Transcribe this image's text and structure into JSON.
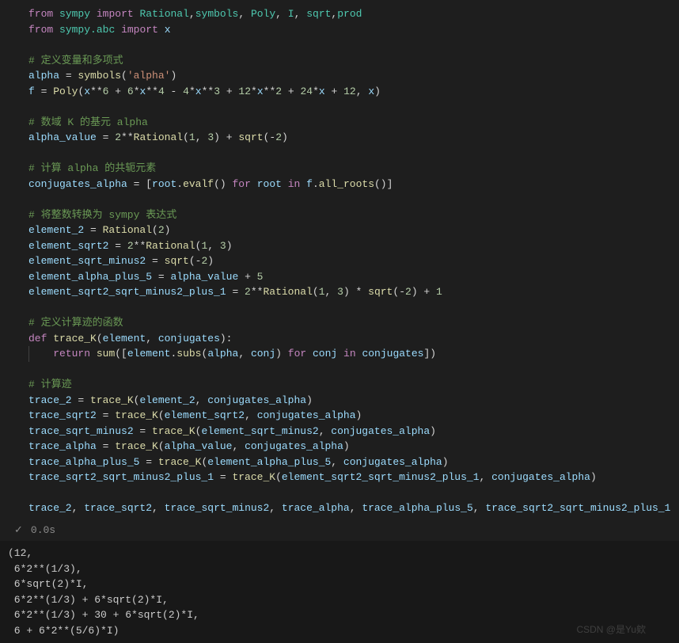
{
  "code": {
    "l1": {
      "from": "from",
      "mod": "sympy",
      "imp": "import",
      "items": "Rational,symbols, Poly, I, sqrt,prod"
    },
    "l2": {
      "from": "from",
      "mod": "sympy.abc",
      "imp": "import",
      "items": "x"
    },
    "l4_cmt": "# 定义变量和多项式",
    "l5": {
      "v": "alpha",
      "eq": " = ",
      "fn": "symbols",
      "args": "'alpha'"
    },
    "l6": {
      "v": "f",
      "eq": " = ",
      "fn": "Poly",
      "expr_a": "x**",
      "n6": "6",
      "p": " + ",
      "n6b": "6",
      "times": "*x**",
      "n4": "4",
      "minus": " - ",
      "n4b": "4",
      "times2": "*x**",
      "n3": "3",
      "plus2": " + ",
      "n12": "12",
      "times3": "*x**",
      "n2": "2",
      "plus3": " + ",
      "n24": "24",
      "times4": "*x + ",
      "n12b": "12",
      "comma": ", x"
    },
    "l8_cmt": "# 数域 K 的基元 alpha",
    "l9": {
      "v": "alpha_value",
      "eq": " = ",
      "n2": "2",
      "dstar": "**",
      "fn": "Rational",
      "args_a": "1",
      "args_b": "3",
      "plus": " + ",
      "fn2": "sqrt",
      "arg2": "-2"
    },
    "l11_cmt": "# 计算 alpha 的共轭元素",
    "l12": {
      "v": "conjugates_alpha",
      "eq": " = [",
      "root": "root",
      ".": ".evalf",
      "paren": "()",
      "for": " for ",
      "root2": "root",
      "in": " in ",
      "f": "f",
      ".2": ".all_roots",
      "paren2": "()]"
    },
    "l14_cmt": "# 将整数转换为 sympy 表达式",
    "l15": {
      "v": "element_2",
      "eq": " = ",
      "fn": "Rational",
      "arg": "2"
    },
    "l16": {
      "v": "element_sqrt2",
      "eq": " = ",
      "n2": "2",
      "dstar": "**",
      "fn": "Rational",
      "a": "1",
      "b": "3"
    },
    "l17": {
      "v": "element_sqrt_minus2",
      "eq": " = ",
      "fn": "sqrt",
      "arg": "-2"
    },
    "l18": {
      "v": "element_alpha_plus_5",
      "eq": " = ",
      "v2": "alpha_value",
      "plus": " + ",
      "n5": "5"
    },
    "l19": {
      "v": "element_sqrt2_sqrt_minus2_plus_1",
      "eq": " = ",
      "n2": "2",
      "dstar": "**",
      "fn": "Rational",
      "a": "1",
      "b": "3",
      "times": " * ",
      "fn2": "sqrt",
      "arg": "-2",
      "plus": " + ",
      "n1": "1"
    },
    "l21_cmt": "# 定义计算迹的函数",
    "l22": {
      "def": "def",
      "name": "trace_K",
      "p1": "element",
      "p2": "conjugates"
    },
    "l23": {
      "ret": "return",
      "fn": "sum",
      "fn2": ".subs",
      "el": "element",
      "alpha": "alpha",
      "conj": "conj",
      "for": "for",
      "conj2": "conj",
      "in": "in",
      "conjs": "conjugates"
    },
    "l25_cmt": "# 计算迹",
    "l26": {
      "v": "trace_2",
      "fn": "trace_K",
      "a": "element_2",
      "b": "conjugates_alpha"
    },
    "l27": {
      "v": "trace_sqrt2",
      "fn": "trace_K",
      "a": "element_sqrt2",
      "b": "conjugates_alpha"
    },
    "l28": {
      "v": "trace_sqrt_minus2",
      "fn": "trace_K",
      "a": "element_sqrt_minus2",
      "b": "conjugates_alpha"
    },
    "l29": {
      "v": "trace_alpha",
      "fn": "trace_K",
      "a": "alpha_value",
      "b": "conjugates_alpha"
    },
    "l30": {
      "v": "trace_alpha_plus_5",
      "fn": "trace_K",
      "a": "element_alpha_plus_5",
      "b": "conjugates_alpha"
    },
    "l31": {
      "v": "trace_sqrt2_sqrt_minus2_plus_1",
      "fn": "trace_K",
      "a": "element_sqrt2_sqrt_minus2_plus_1",
      "b": "conjugates_alpha"
    },
    "l33": {
      "a": "trace_2",
      "b": "trace_sqrt2",
      "c": "trace_sqrt_minus2",
      "d": "trace_alpha",
      "e": "trace_alpha_plus_5",
      "f": "trace_sqrt2_sqrt_minus2_plus_1"
    }
  },
  "status": {
    "check": "✓",
    "time": "0.0s"
  },
  "output": "(12,\n 6*2**(1/3),\n 6*sqrt(2)*I,\n 6*2**(1/3) + 6*sqrt(2)*I,\n 6*2**(1/3) + 30 + 6*sqrt(2)*I,\n 6 + 6*2**(5/6)*I)",
  "watermark": "",
  "footer": "CSDN @是Yu欸"
}
